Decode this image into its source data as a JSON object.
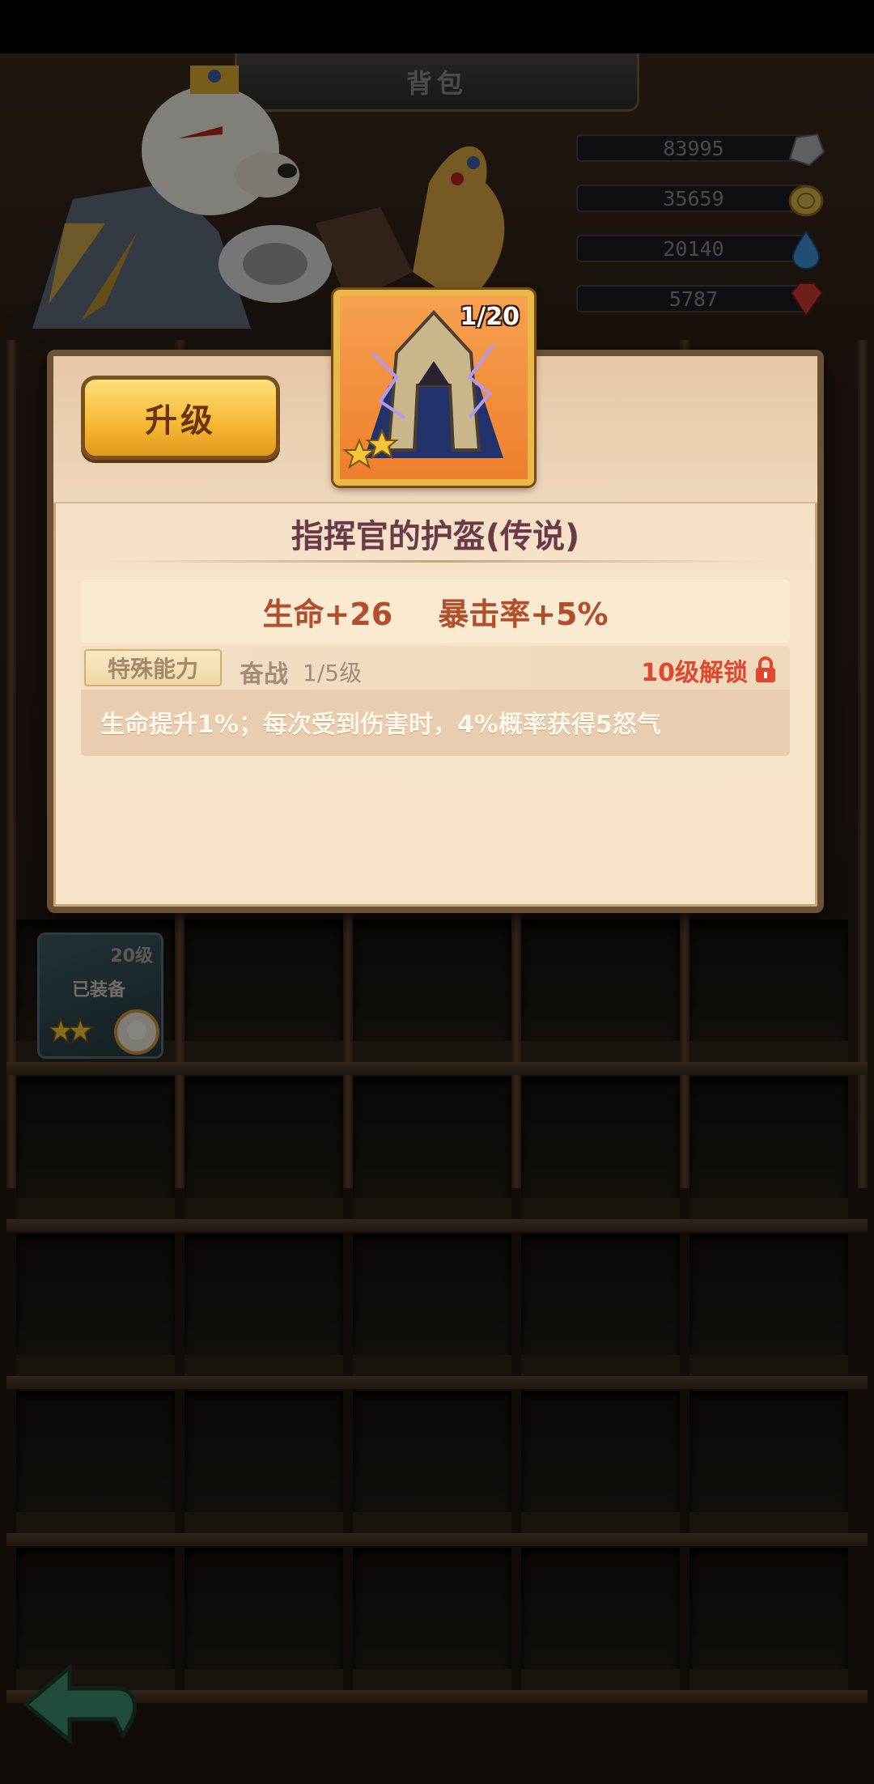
{
  "window": {
    "title": "背包"
  },
  "resources": [
    {
      "value": "83995",
      "icon": "stone-icon",
      "color": "#a9b0b3"
    },
    {
      "value": "35659",
      "icon": "gold-coin-icon",
      "color": "#d8b24a"
    },
    {
      "value": "20140",
      "icon": "water-drop-icon",
      "color": "#3f8fd1"
    },
    {
      "value": "5787",
      "icon": "red-gem-icon",
      "color": "#c93a34"
    }
  ],
  "equipped_slot": {
    "level_label": "20级",
    "status_label": "已装备",
    "stars": 2
  },
  "popup": {
    "upgrade_label": "升级",
    "item": {
      "count": "1/20",
      "stars": 2,
      "icon": "helmet-icon",
      "name": "指挥官的护盔(传说)"
    },
    "stats": [
      "生命+26",
      "暴击率+5%"
    ],
    "ability": {
      "tag": "特殊能力",
      "name": "奋战",
      "level": "1/5级",
      "unlock_label": "10级解锁",
      "description": "生命提升1%；每次受到伤害时，4%概率获得5怒气"
    }
  },
  "colors": {
    "accent": "#f6b733",
    "panel": "#f6e3c9",
    "warning": "#e0472e"
  }
}
